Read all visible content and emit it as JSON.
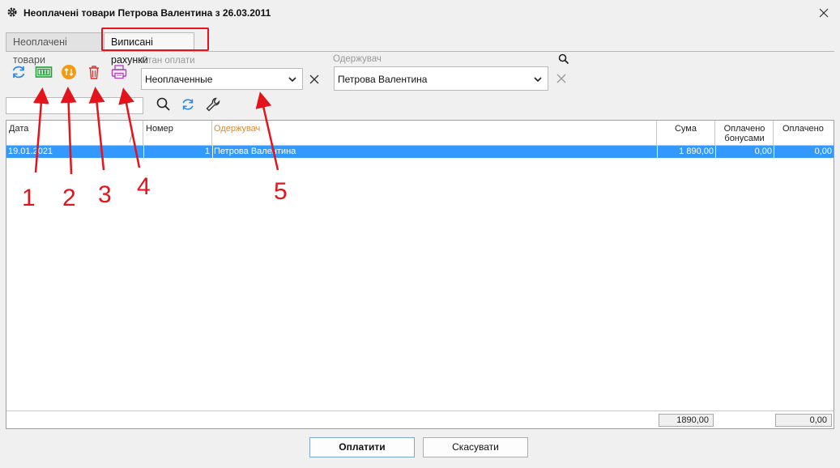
{
  "window": {
    "title": "Неоплачені товари Петрова Валентина з 26.03.2011"
  },
  "tabs": [
    {
      "label": "Неоплачені товари"
    },
    {
      "label": "Виписані рахунки"
    }
  ],
  "filters": {
    "payment_state_label": "Стан оплати",
    "payment_state_value": "Неоплаченные",
    "recipient_label": "Одержувач",
    "recipient_value": "Петрова Валентина"
  },
  "table": {
    "headers": {
      "date": "Дата",
      "number": "Номер",
      "recipient": "Одержувач",
      "sum": "Сума",
      "paid_bonus": "Оплачено бонусами",
      "paid": "Оплачено"
    },
    "rows": [
      {
        "date": "19.01.2021",
        "number": "1",
        "recipient": "Петрова Валентина",
        "sum": "1 890,00",
        "paid_bonus": "0,00",
        "paid": "0,00"
      }
    ],
    "totals": {
      "sum": "1890,00",
      "paid": "0,00"
    }
  },
  "buttons": {
    "pay": "Оплатити",
    "cancel": "Скасувати"
  },
  "annotations": [
    "1",
    "2",
    "3",
    "4",
    "5"
  ],
  "colors": {
    "highlight": "#e3141b",
    "selection": "#3399ff",
    "accent_header": "#e08a2c"
  }
}
